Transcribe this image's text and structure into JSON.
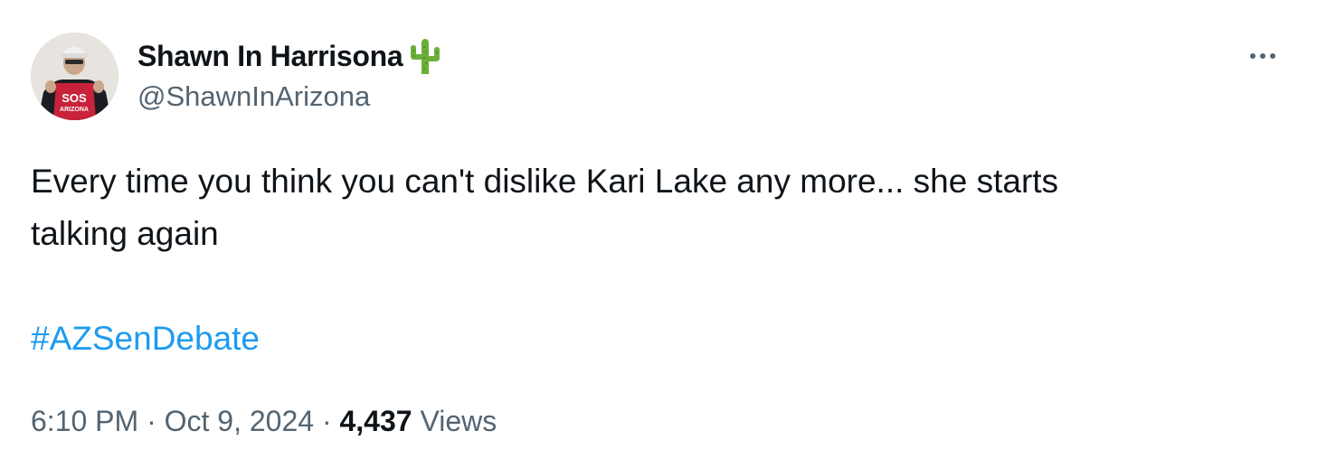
{
  "user": {
    "display_name": "Shawn In Harrisona",
    "handle": "@ShawnInArizona",
    "name_emoji": "cactus-icon",
    "avatar_shirt_text": "SOS",
    "avatar_shirt_subtext": "ARIZONA"
  },
  "tweet": {
    "text": "Every time you think you can't dislike Kari Lake any more... she starts\ntalking again",
    "hashtag": "#AZSenDebate"
  },
  "meta": {
    "time": "6:10 PM",
    "separator": " · ",
    "date": "Oct 9, 2024",
    "views_count": "4,437",
    "views_label": " Views"
  },
  "colors": {
    "link": "#1d9bf0",
    "secondary_text": "#536471",
    "primary_text": "#0f1419",
    "cactus": "#6cae3a"
  }
}
